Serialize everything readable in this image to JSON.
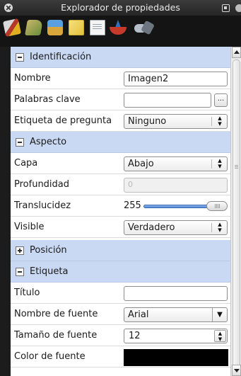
{
  "window": {
    "title": "Explorador de propiedades"
  },
  "toolbar": {
    "icons": [
      "blocks-icon",
      "paint-icon",
      "scene-icon",
      "notes-icon",
      "document-icon",
      "spinning-top-icon",
      "sound-icon"
    ]
  },
  "sections": {
    "identificacion": {
      "label": "Identificación",
      "expanded": true
    },
    "aspecto": {
      "label": "Aspecto",
      "expanded": true
    },
    "posicion": {
      "label": "Posición",
      "expanded": false
    },
    "etiqueta": {
      "label": "Etiqueta",
      "expanded": true
    }
  },
  "props": {
    "nombre": {
      "label": "Nombre",
      "value": "Imagen2"
    },
    "palabras_clave": {
      "label": "Palabras clave",
      "value": "",
      "button": "..."
    },
    "etiqueta_pregunta": {
      "label": "Etiqueta de pregunta",
      "value": "Ninguno"
    },
    "capa": {
      "label": "Capa",
      "value": "Abajo"
    },
    "profundidad": {
      "label": "Profundidad",
      "value": "0"
    },
    "translucidez": {
      "label": "Translucidez",
      "value": "255",
      "fraction": 1.0
    },
    "visible": {
      "label": "Visible",
      "value": "Verdadero"
    },
    "titulo": {
      "label": "Título",
      "value": ""
    },
    "nombre_fuente": {
      "label": "Nombre de fuente",
      "value": "Arial"
    },
    "tamano_fuente": {
      "label": "Tamaño de fuente",
      "value": "12"
    },
    "color_fuente": {
      "label": "Color de fuente",
      "value": "#000000"
    }
  },
  "colors": {
    "section_bg": "#cad9f3",
    "slider_fill": "#4d86d6"
  }
}
